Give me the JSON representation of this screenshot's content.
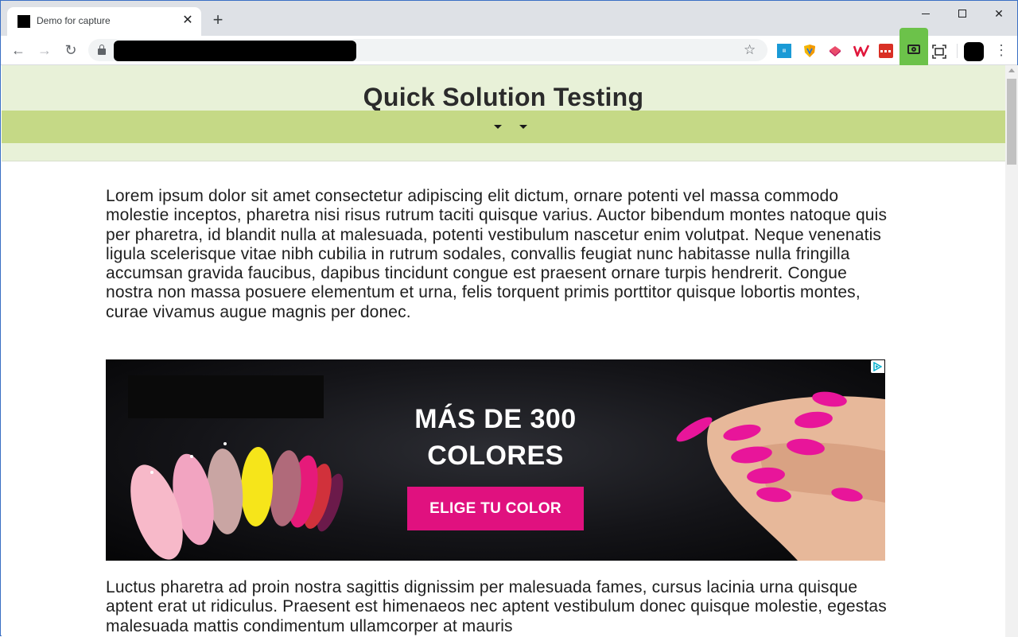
{
  "browser": {
    "tab_title": "Demo for capture",
    "tab_close_glyph": "✕",
    "new_tab_glyph": "+",
    "back_glyph": "←",
    "forward_glyph": "→",
    "reload_glyph": "↻",
    "star_glyph": "☆",
    "menu_glyph": "⋮",
    "minimize_icon": "minimize-icon",
    "maximize_icon": "maximize-icon",
    "close_glyph": "✕",
    "extensions": [
      "blue-extension-icon",
      "shield-extension-icon",
      "pink-extension-icon",
      "red-w-extension-icon",
      "red-dots-extension-icon",
      "camera-capture-icon",
      "screen-capture-icon"
    ],
    "capture_color": "#6cc24a"
  },
  "site": {
    "title": "Quick Solution Testing",
    "header_bg": "#e8f1d8",
    "nav_bg": "#c5d986"
  },
  "content": {
    "paragraph_1": "Lorem ipsum dolor sit amet consectetur adipiscing elit dictum, ornare potenti vel massa commodo molestie inceptos, pharetra nisi risus rutrum taciti quisque varius. Auctor bibendum montes natoque quis per pharetra, id blandit nulla at malesuada, potenti vestibulum nascetur enim volutpat. Neque venenatis ligula scelerisque vitae nibh cubilia in rutrum sodales, convallis feugiat nunc habitasse nulla fringilla accumsan gravida faucibus, dapibus tincidunt congue est praesent ornare turpis hendrerit. Congue nostra non massa posuere elementum et urna, felis torquent primis porttitor quisque lobortis montes, curae vivamus augue magnis per donec.",
    "paragraph_2": "Luctus pharetra ad proin nostra sagittis dignissim per malesuada fames, cursus lacinia urna quisque aptent erat ut ridiculus. Praesent est himenaeos nec aptent vestibulum donec quisque molestie, egestas malesuada mattis condimentum ullamcorper at mauris"
  },
  "ad": {
    "headline_line_1": "MÁS DE 300",
    "headline_line_2": "COLORES",
    "cta_label": "ELIGE TU COLOR",
    "cta_color": "#e0117f",
    "nail_color": "#e8159a"
  }
}
